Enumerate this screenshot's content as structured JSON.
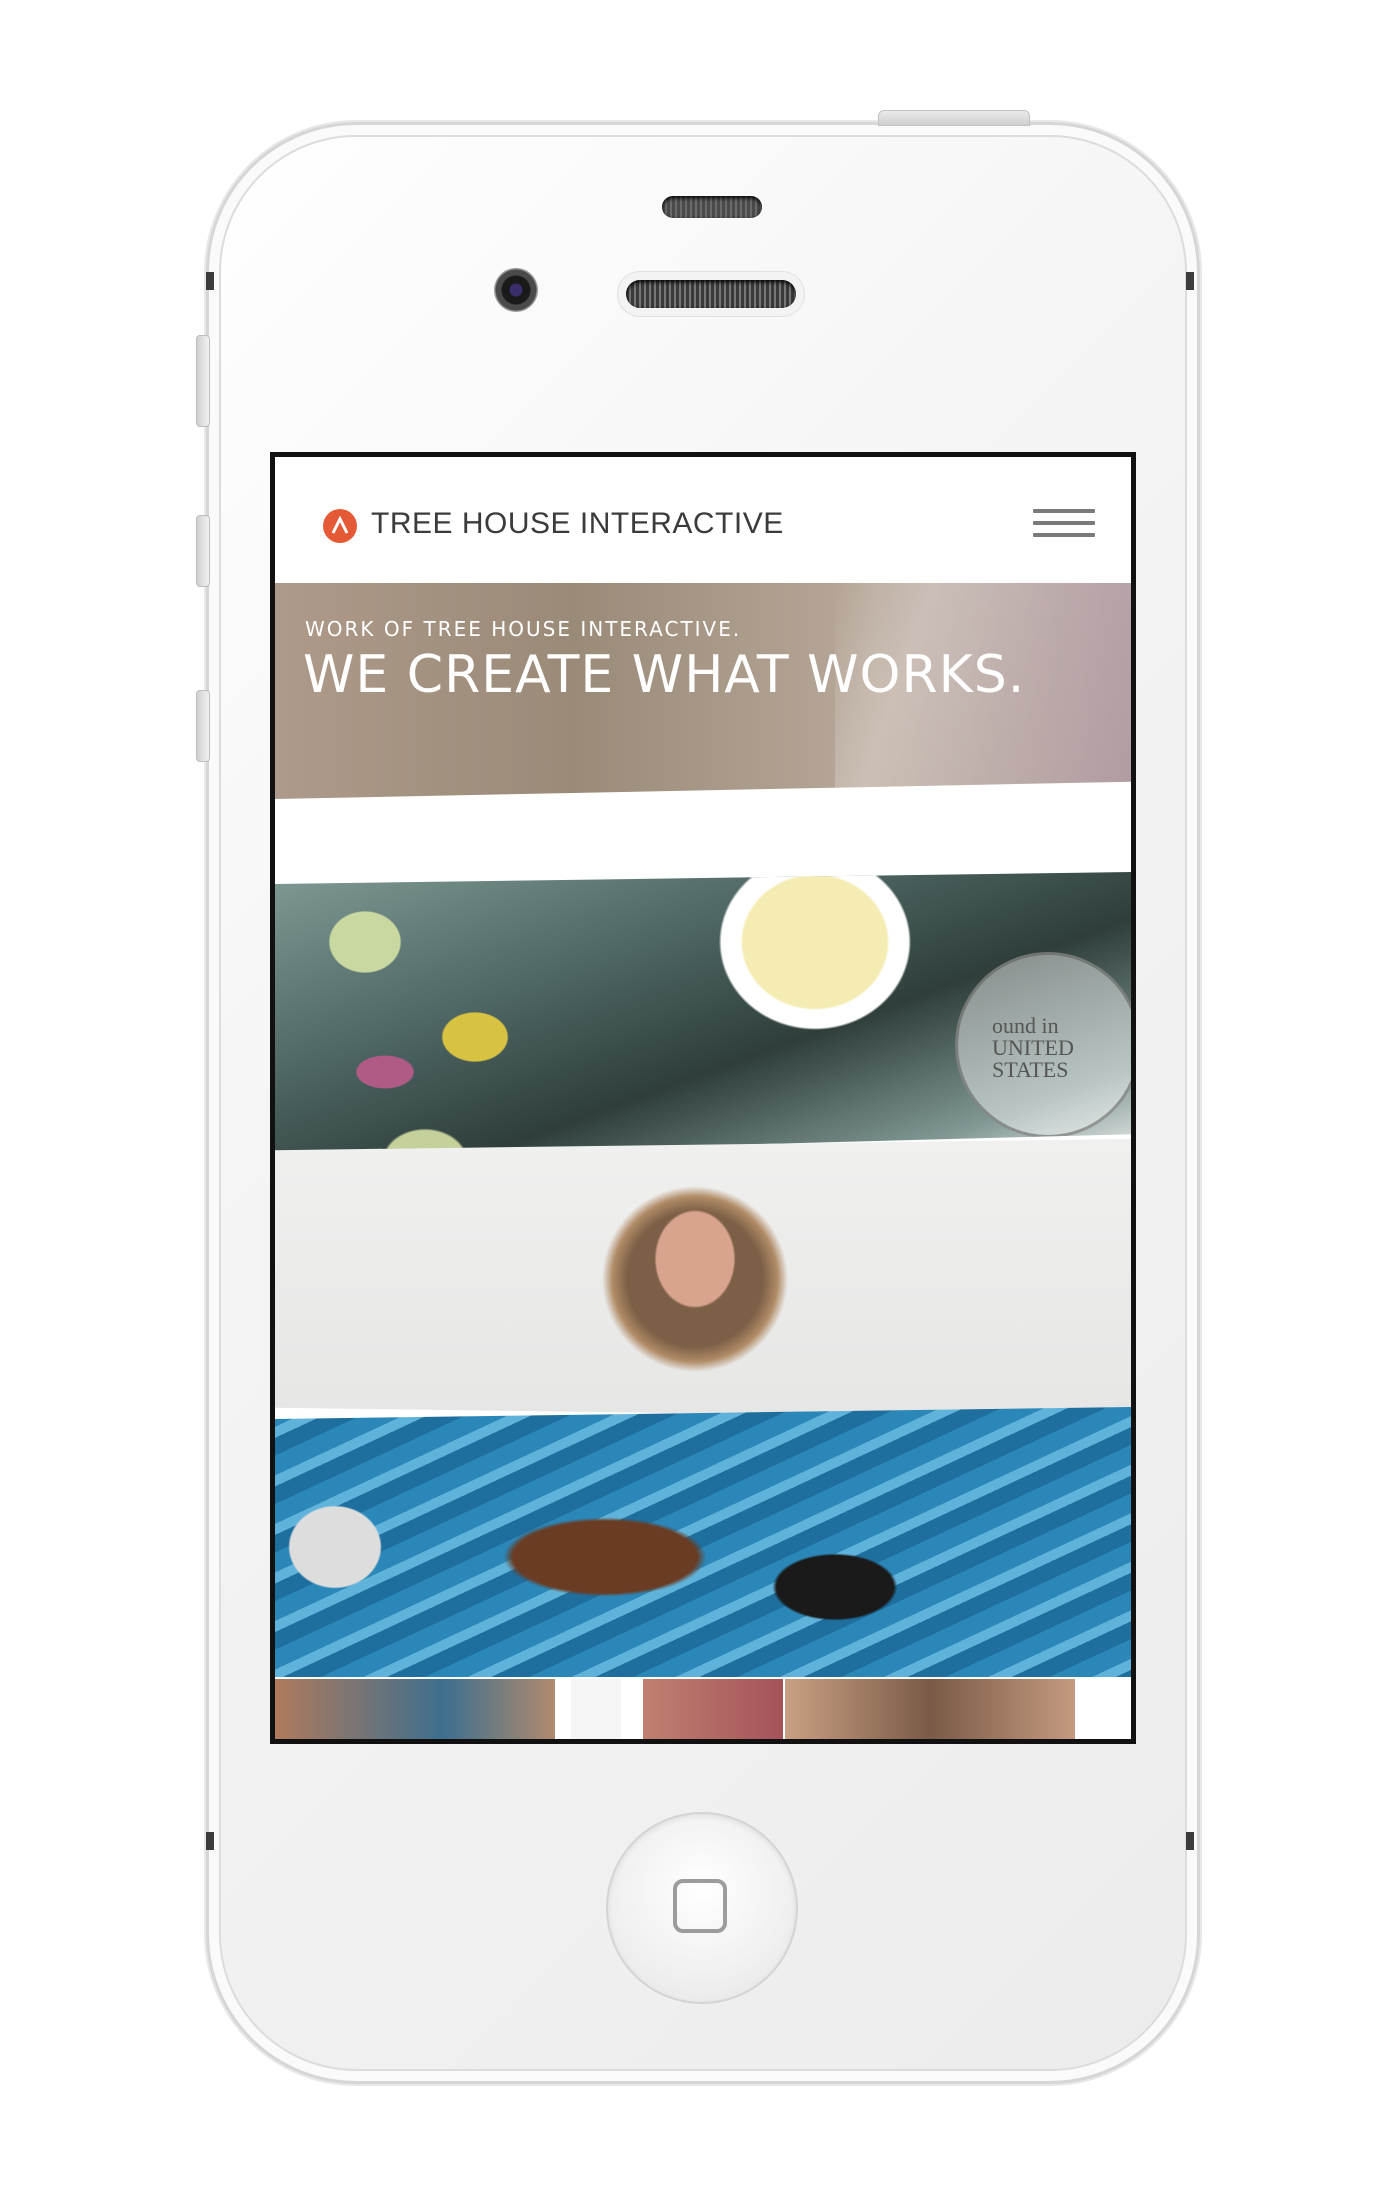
{
  "site": {
    "brand": "TREE HOUSE INTERACTIVE",
    "brand_color": "#e45a36"
  },
  "hero": {
    "subtitle": "WORK OF TREE HOUSE INTERACTIVE.",
    "title": "WE CREATE WHAT WORKS."
  },
  "stamp": {
    "line1": "ound in",
    "line2": "UNITED",
    "line3": "STATES"
  },
  "icons": {
    "logo": "triangle-logo-icon",
    "menu": "hamburger-menu-icon",
    "home": "home-button-icon"
  }
}
